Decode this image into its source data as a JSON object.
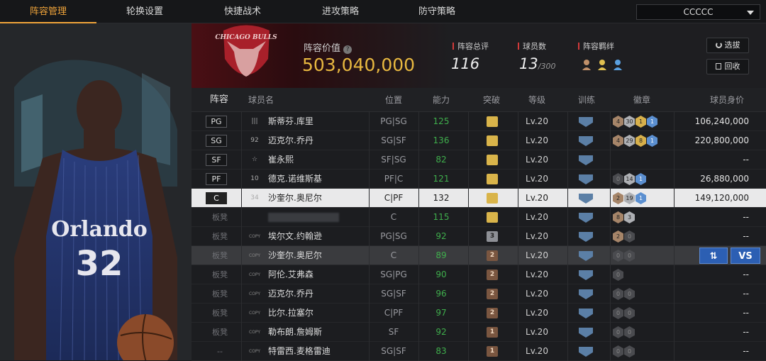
{
  "tabs": [
    "阵容管理",
    "轮换设置",
    "快捷战术",
    "进攻策略",
    "防守策略"
  ],
  "active_tab": "阵容管理",
  "team_select": {
    "value": "CCCCC"
  },
  "player_jersey": {
    "team": "Orlando",
    "number": "32"
  },
  "logo_text": "CHICAGO BULLS",
  "header": {
    "value_label": "阵容价值",
    "value": "503,040,000",
    "rating_label": "阵容总评",
    "rating": "116",
    "count_label": "球员数",
    "count": "13",
    "count_max": "/300",
    "bond_label": "阵容羁绊",
    "btn_choose": "选拔",
    "btn_recycle": "回收"
  },
  "columns": [
    "阵容",
    "球员名",
    "位置",
    "能力",
    "突破",
    "等级",
    "训练",
    "徽章",
    "球员身价"
  ],
  "rows": [
    {
      "slot": "PG",
      "starter": true,
      "jersey": "|||",
      "name": "斯蒂芬.库里",
      "pos": "PG|SG",
      "ability": "125",
      "ab_green": true,
      "break": "",
      "break_type": "gold",
      "level": "Lv.20",
      "badges": [
        [
          "b",
          "4"
        ],
        [
          "s",
          "30"
        ],
        [
          "g",
          "1"
        ],
        [
          "bl",
          "1"
        ]
      ],
      "price": "106,240,000"
    },
    {
      "slot": "SG",
      "starter": true,
      "jersey": "92",
      "name": "迈克尔.乔丹",
      "pos": "SG|SF",
      "ability": "136",
      "ab_green": true,
      "break": "",
      "break_type": "gold",
      "level": "Lv.20",
      "badges": [
        [
          "b",
          "4"
        ],
        [
          "s",
          "29"
        ],
        [
          "g",
          "8"
        ],
        [
          "bl",
          "1"
        ]
      ],
      "price": "220,800,000"
    },
    {
      "slot": "SF",
      "starter": true,
      "jersey": "☆",
      "name": "崔永熙",
      "pos": "SF|SG",
      "ability": "82",
      "ab_green": true,
      "break": "",
      "break_type": "gold",
      "level": "Lv.20",
      "badges": [],
      "price": "--"
    },
    {
      "slot": "PF",
      "starter": true,
      "jersey": "10",
      "name": "德克.诺维斯基",
      "pos": "PF|C",
      "ability": "121",
      "ab_green": true,
      "break": "",
      "break_type": "gold",
      "level": "Lv.20",
      "badges": [
        [
          "e",
          "0"
        ],
        [
          "s",
          "14"
        ],
        [
          "bl",
          "1"
        ]
      ],
      "price": "26,880,000"
    },
    {
      "slot": "C",
      "starter": true,
      "selected": true,
      "jersey": "34",
      "name": "沙奎尔.奥尼尔",
      "pos": "C|PF",
      "ability": "132",
      "ab_green": false,
      "break": "",
      "break_type": "gold",
      "level": "Lv.20",
      "badges": [
        [
          "b",
          "2"
        ],
        [
          "s",
          "19"
        ],
        [
          "bl",
          "1"
        ]
      ],
      "price": "149,120,000"
    },
    {
      "slot": "板凳",
      "starter": false,
      "jersey": "",
      "name": "",
      "blurred": true,
      "pos": "C",
      "ability": "115",
      "ab_green": true,
      "break": "",
      "break_type": "gold",
      "level": "Lv.20",
      "badges": [
        [
          "b",
          "8"
        ],
        [
          "s",
          "3"
        ]
      ],
      "price": "--"
    },
    {
      "slot": "板凳",
      "starter": false,
      "jersey": "COPY",
      "name": "埃尔文.约翰逊",
      "pos": "PG|SG",
      "ability": "92",
      "ab_green": true,
      "break": "3",
      "break_type": "silver",
      "level": "Lv.20",
      "badges": [
        [
          "b",
          "2"
        ],
        [
          "e",
          "0"
        ]
      ],
      "price": "--"
    },
    {
      "slot": "板凳",
      "starter": false,
      "highlight": true,
      "jersey": "COPY",
      "name": "沙奎尔.奥尼尔",
      "pos": "C",
      "ability": "89",
      "ab_green": true,
      "break": "2",
      "break_type": "bronze",
      "level": "Lv.20",
      "badges": [
        [
          "e",
          "0"
        ],
        [
          "e",
          "0"
        ]
      ],
      "price": ""
    },
    {
      "slot": "板凳",
      "starter": false,
      "jersey": "COPY",
      "name": "阿伦.艾弗森",
      "pos": "SG|PG",
      "ability": "90",
      "ab_green": true,
      "break": "2",
      "break_type": "bronze",
      "level": "Lv.20",
      "badges": [
        [
          "e",
          "0"
        ]
      ],
      "price": "--"
    },
    {
      "slot": "板凳",
      "starter": false,
      "jersey": "COPY",
      "name": "迈克尔.乔丹",
      "pos": "SG|SF",
      "ability": "96",
      "ab_green": true,
      "break": "2",
      "break_type": "bronze",
      "level": "Lv.20",
      "badges": [
        [
          "e",
          "0"
        ],
        [
          "e",
          "0"
        ]
      ],
      "price": "--"
    },
    {
      "slot": "板凳",
      "starter": false,
      "jersey": "COPY",
      "name": "比尔.拉塞尔",
      "pos": "C|PF",
      "ability": "97",
      "ab_green": true,
      "break": "2",
      "break_type": "bronze",
      "level": "Lv.20",
      "badges": [
        [
          "e",
          "0"
        ],
        [
          "e",
          "0"
        ]
      ],
      "price": "--"
    },
    {
      "slot": "板凳",
      "starter": false,
      "jersey": "COPY",
      "name": "勒布朗.詹姆斯",
      "pos": "SF",
      "ability": "92",
      "ab_green": true,
      "break": "1",
      "break_type": "bronze",
      "level": "Lv.20",
      "badges": [
        [
          "e",
          "0"
        ],
        [
          "e",
          "0"
        ]
      ],
      "price": "--"
    },
    {
      "slot": "--",
      "starter": false,
      "jersey": "COPY",
      "name": "特雷西.麦格雷迪",
      "pos": "SG|SF",
      "ability": "83",
      "ab_green": true,
      "break": "1",
      "break_type": "bronze",
      "level": "Lv.20",
      "badges": [
        [
          "e",
          "0"
        ],
        [
          "e",
          "0"
        ]
      ],
      "price": "--"
    }
  ],
  "row_actions": {
    "swap_icon": "swap-icon",
    "vs_label": "VS"
  }
}
